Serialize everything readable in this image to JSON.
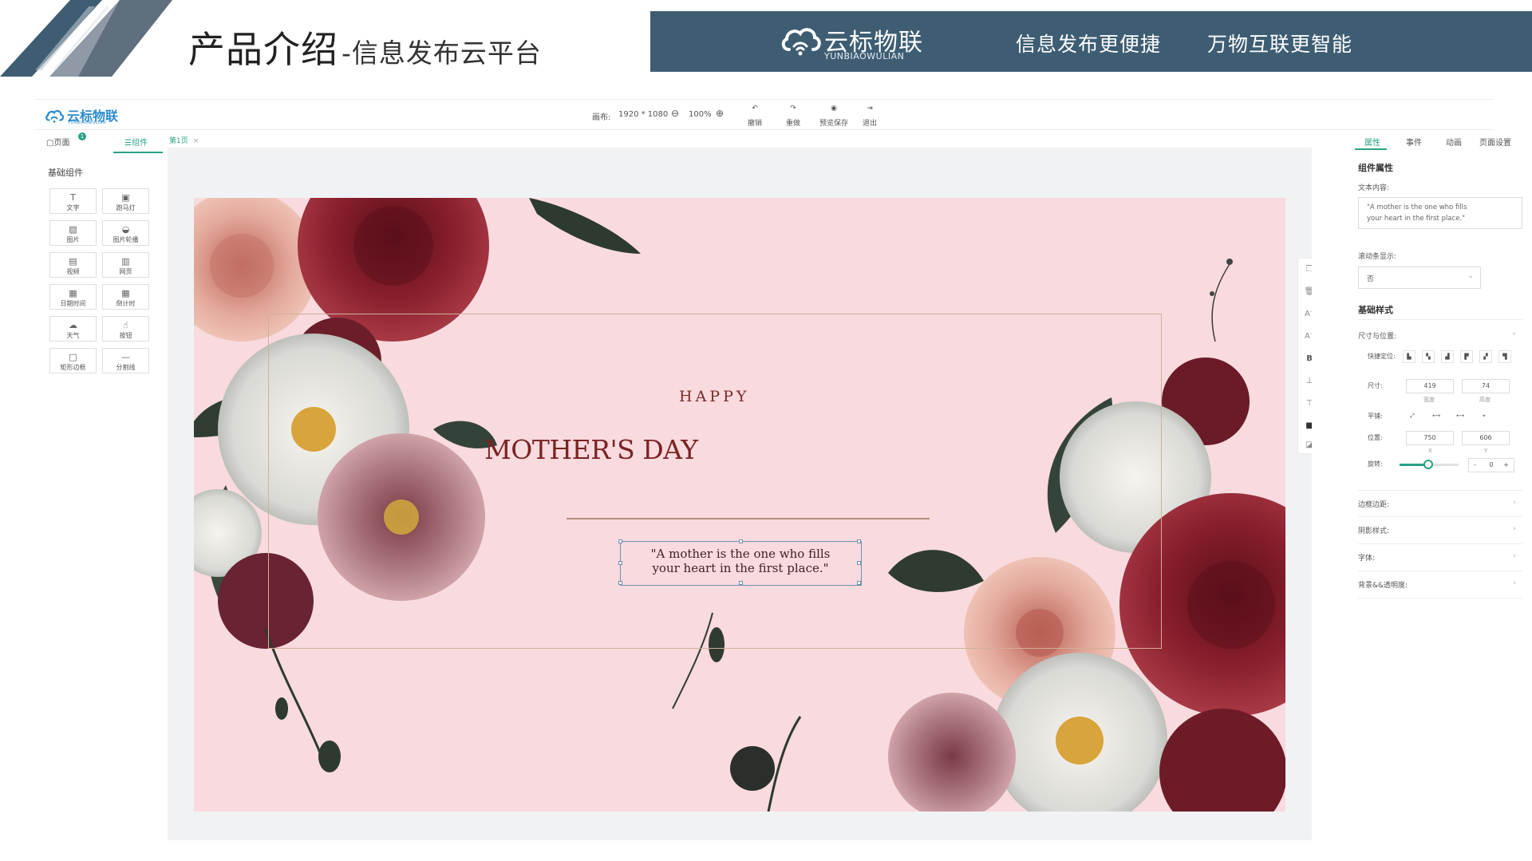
{
  "slide": {
    "title_main": "产品介绍",
    "title_sub": "-信息发布云平台",
    "banner": {
      "logo_cn": "云标物联",
      "logo_en": "YUNBIAOWULIAN",
      "slogan_1": "信息发布更便捷",
      "slogan_2": "万物互联更智能"
    }
  },
  "editor": {
    "app_logo_cn": "云标物联",
    "app_logo_en": "YUNBIAOWULIAN",
    "topbar": {
      "canvas_label": "画布:",
      "canvas_size": "1920 * 1080",
      "zoom": "100%",
      "tools": [
        "撤销",
        "重做",
        "预览保存",
        "退出"
      ]
    },
    "left_panel": {
      "tabs": [
        "页面",
        "组件"
      ],
      "page_badge": "1",
      "section_title": "基础组件",
      "components": [
        "文字",
        "跑马灯",
        "图片",
        "图片轮播",
        "视频",
        "网页",
        "日期时间",
        "倒计时",
        "天气",
        "按钮",
        "矩形边框",
        "分割线"
      ]
    },
    "page_tab": "第1页",
    "page_tab_close": "×",
    "canvas": {
      "happy": "HAPPY",
      "mothers_day": "MOTHER'S DAY",
      "quote_line1": "\"A mother is the one who fills",
      "quote_line2": "your heart in the first place.\""
    },
    "right_panel": {
      "tabs": [
        "属性",
        "事件",
        "动画",
        "页面设置"
      ],
      "component_props": "组件属性",
      "text_content_label": "文本内容:",
      "text_content_line1": "\"A mother is the one who fills",
      "text_content_line2": "your heart in the first place.\"",
      "scrollbar_label": "滚动条显示:",
      "scrollbar_value": "否",
      "basic_style": "基础样式",
      "size_position": "尺寸与位置:",
      "quick_position": "快捷定位:",
      "size_label": "尺寸:",
      "width": "419",
      "width_sub": "宽度",
      "height": "74",
      "height_sub": "高度",
      "tile_label": "平铺:",
      "position_label": "位置:",
      "pos_x": "750",
      "pos_x_sub": "X",
      "pos_y": "606",
      "pos_y_sub": "Y",
      "rotate_label": "旋转:",
      "rotate_value": "0",
      "minus": "-",
      "plus": "+",
      "collapsibles": [
        "边框边距:",
        "阴影样式:",
        "字体:",
        "背景&&透明度:"
      ]
    }
  },
  "colors": {
    "banner": "#3e5d73",
    "accent": "#2aa187",
    "canvas_bg": "#f9dade",
    "title_red": "#7a2323"
  }
}
